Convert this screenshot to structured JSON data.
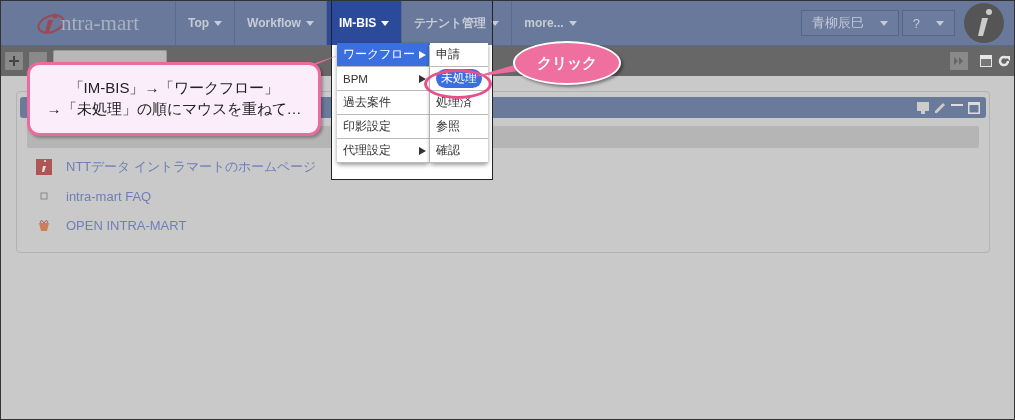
{
  "header": {
    "nav": [
      {
        "label": "Top",
        "selected": false
      },
      {
        "label": "Workflow",
        "selected": false
      },
      {
        "label": "IM-BIS",
        "selected": true
      },
      {
        "label": "テナント管理",
        "selected": false
      },
      {
        "label": "more...",
        "selected": false
      }
    ],
    "logo": "ntra-mart",
    "user": "青柳辰巳",
    "help": "?"
  },
  "menu": {
    "items": [
      {
        "label": "ワークフロー",
        "selected": true,
        "submenu": true
      },
      {
        "label": "BPM",
        "selected": false,
        "submenu": true
      },
      {
        "label": "過去案件",
        "selected": false,
        "submenu": false
      },
      {
        "label": "印影設定",
        "selected": false,
        "submenu": false
      },
      {
        "label": "代理設定",
        "selected": false,
        "submenu": true
      }
    ],
    "submenu": [
      {
        "label": "申請",
        "selected": false
      },
      {
        "label": "未処理",
        "selected": true
      },
      {
        "label": "処理済",
        "selected": false
      },
      {
        "label": "参照",
        "selected": false
      },
      {
        "label": "確認",
        "selected": false
      }
    ]
  },
  "portlet": {
    "links": [
      {
        "label": "NTTデータ イントラマートのホームページ"
      },
      {
        "label": "intra-mart FAQ"
      },
      {
        "label": "OPEN INTRA-MART"
      }
    ]
  },
  "callouts": {
    "instruction": [
      "「IM-BIS」→「ワークフロー」",
      "→「未処理」の順にマウスを重ねて…"
    ],
    "action": "クリック"
  }
}
